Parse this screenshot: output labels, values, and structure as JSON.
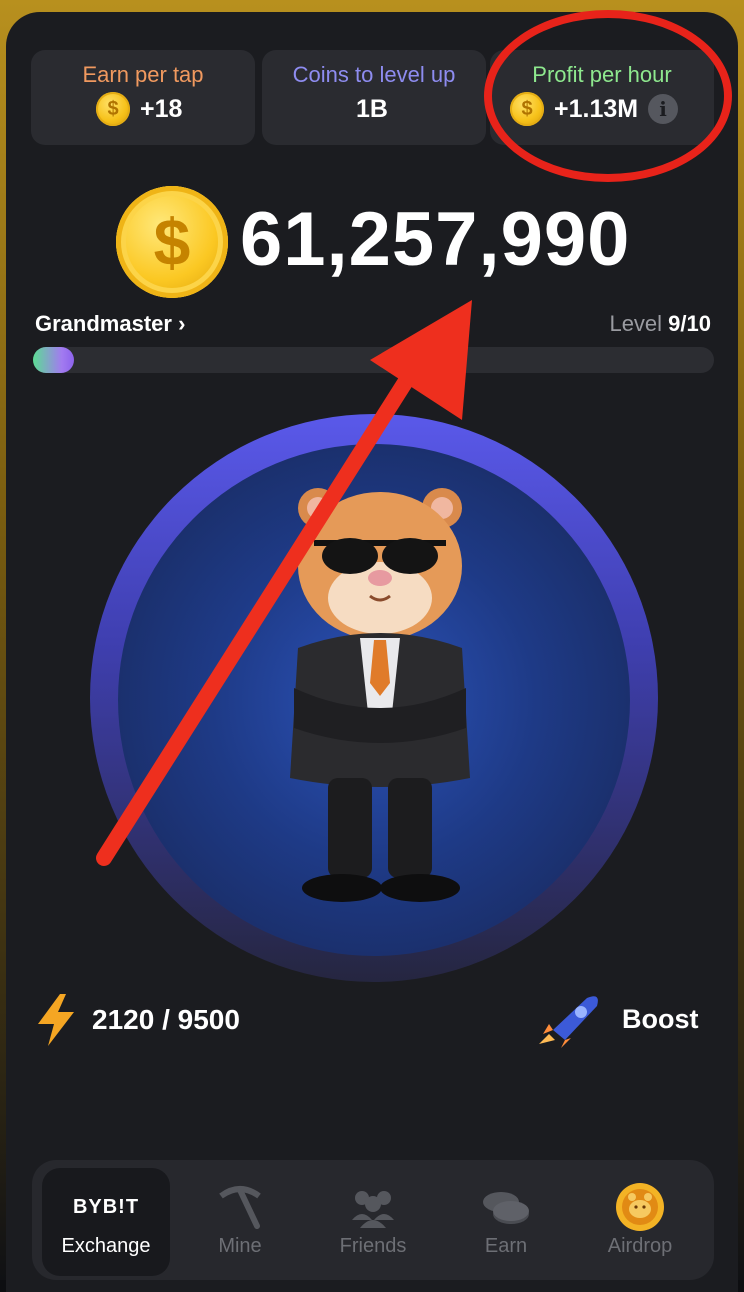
{
  "stats": {
    "earn_per_tap": {
      "label": "Earn per tap",
      "value": "+18",
      "label_color": "#f0995f"
    },
    "coins_to_level_up": {
      "label": "Coins to level up",
      "value": "1B",
      "label_color": "#8e8cf0"
    },
    "profit_per_hour": {
      "label": "Profit per hour",
      "value": "+1.13M",
      "label_color": "#8ee88e"
    }
  },
  "balance": "61,257,990",
  "rank": "Grandmaster",
  "level": {
    "prefix": "Level",
    "value": "9/10"
  },
  "progress_fraction": 0.06,
  "energy": "2120 / 9500",
  "boost": "Boost",
  "coin_symbol": "$",
  "info_symbol": "i",
  "rank_chevron": "›",
  "nav": [
    {
      "label": "Exchange",
      "icon": "bybit-logo",
      "logo_text": "BYB!T",
      "active": true
    },
    {
      "label": "Mine",
      "icon": "pickaxe-icon",
      "active": false
    },
    {
      "label": "Friends",
      "icon": "friends-icon",
      "active": false
    },
    {
      "label": "Earn",
      "icon": "coins-icon",
      "active": false
    },
    {
      "label": "Airdrop",
      "icon": "hamster-coin-icon",
      "active": false
    }
  ],
  "annotations": {
    "highlight_color": "#e8231a",
    "arrow_color": "#ee2f1e"
  }
}
